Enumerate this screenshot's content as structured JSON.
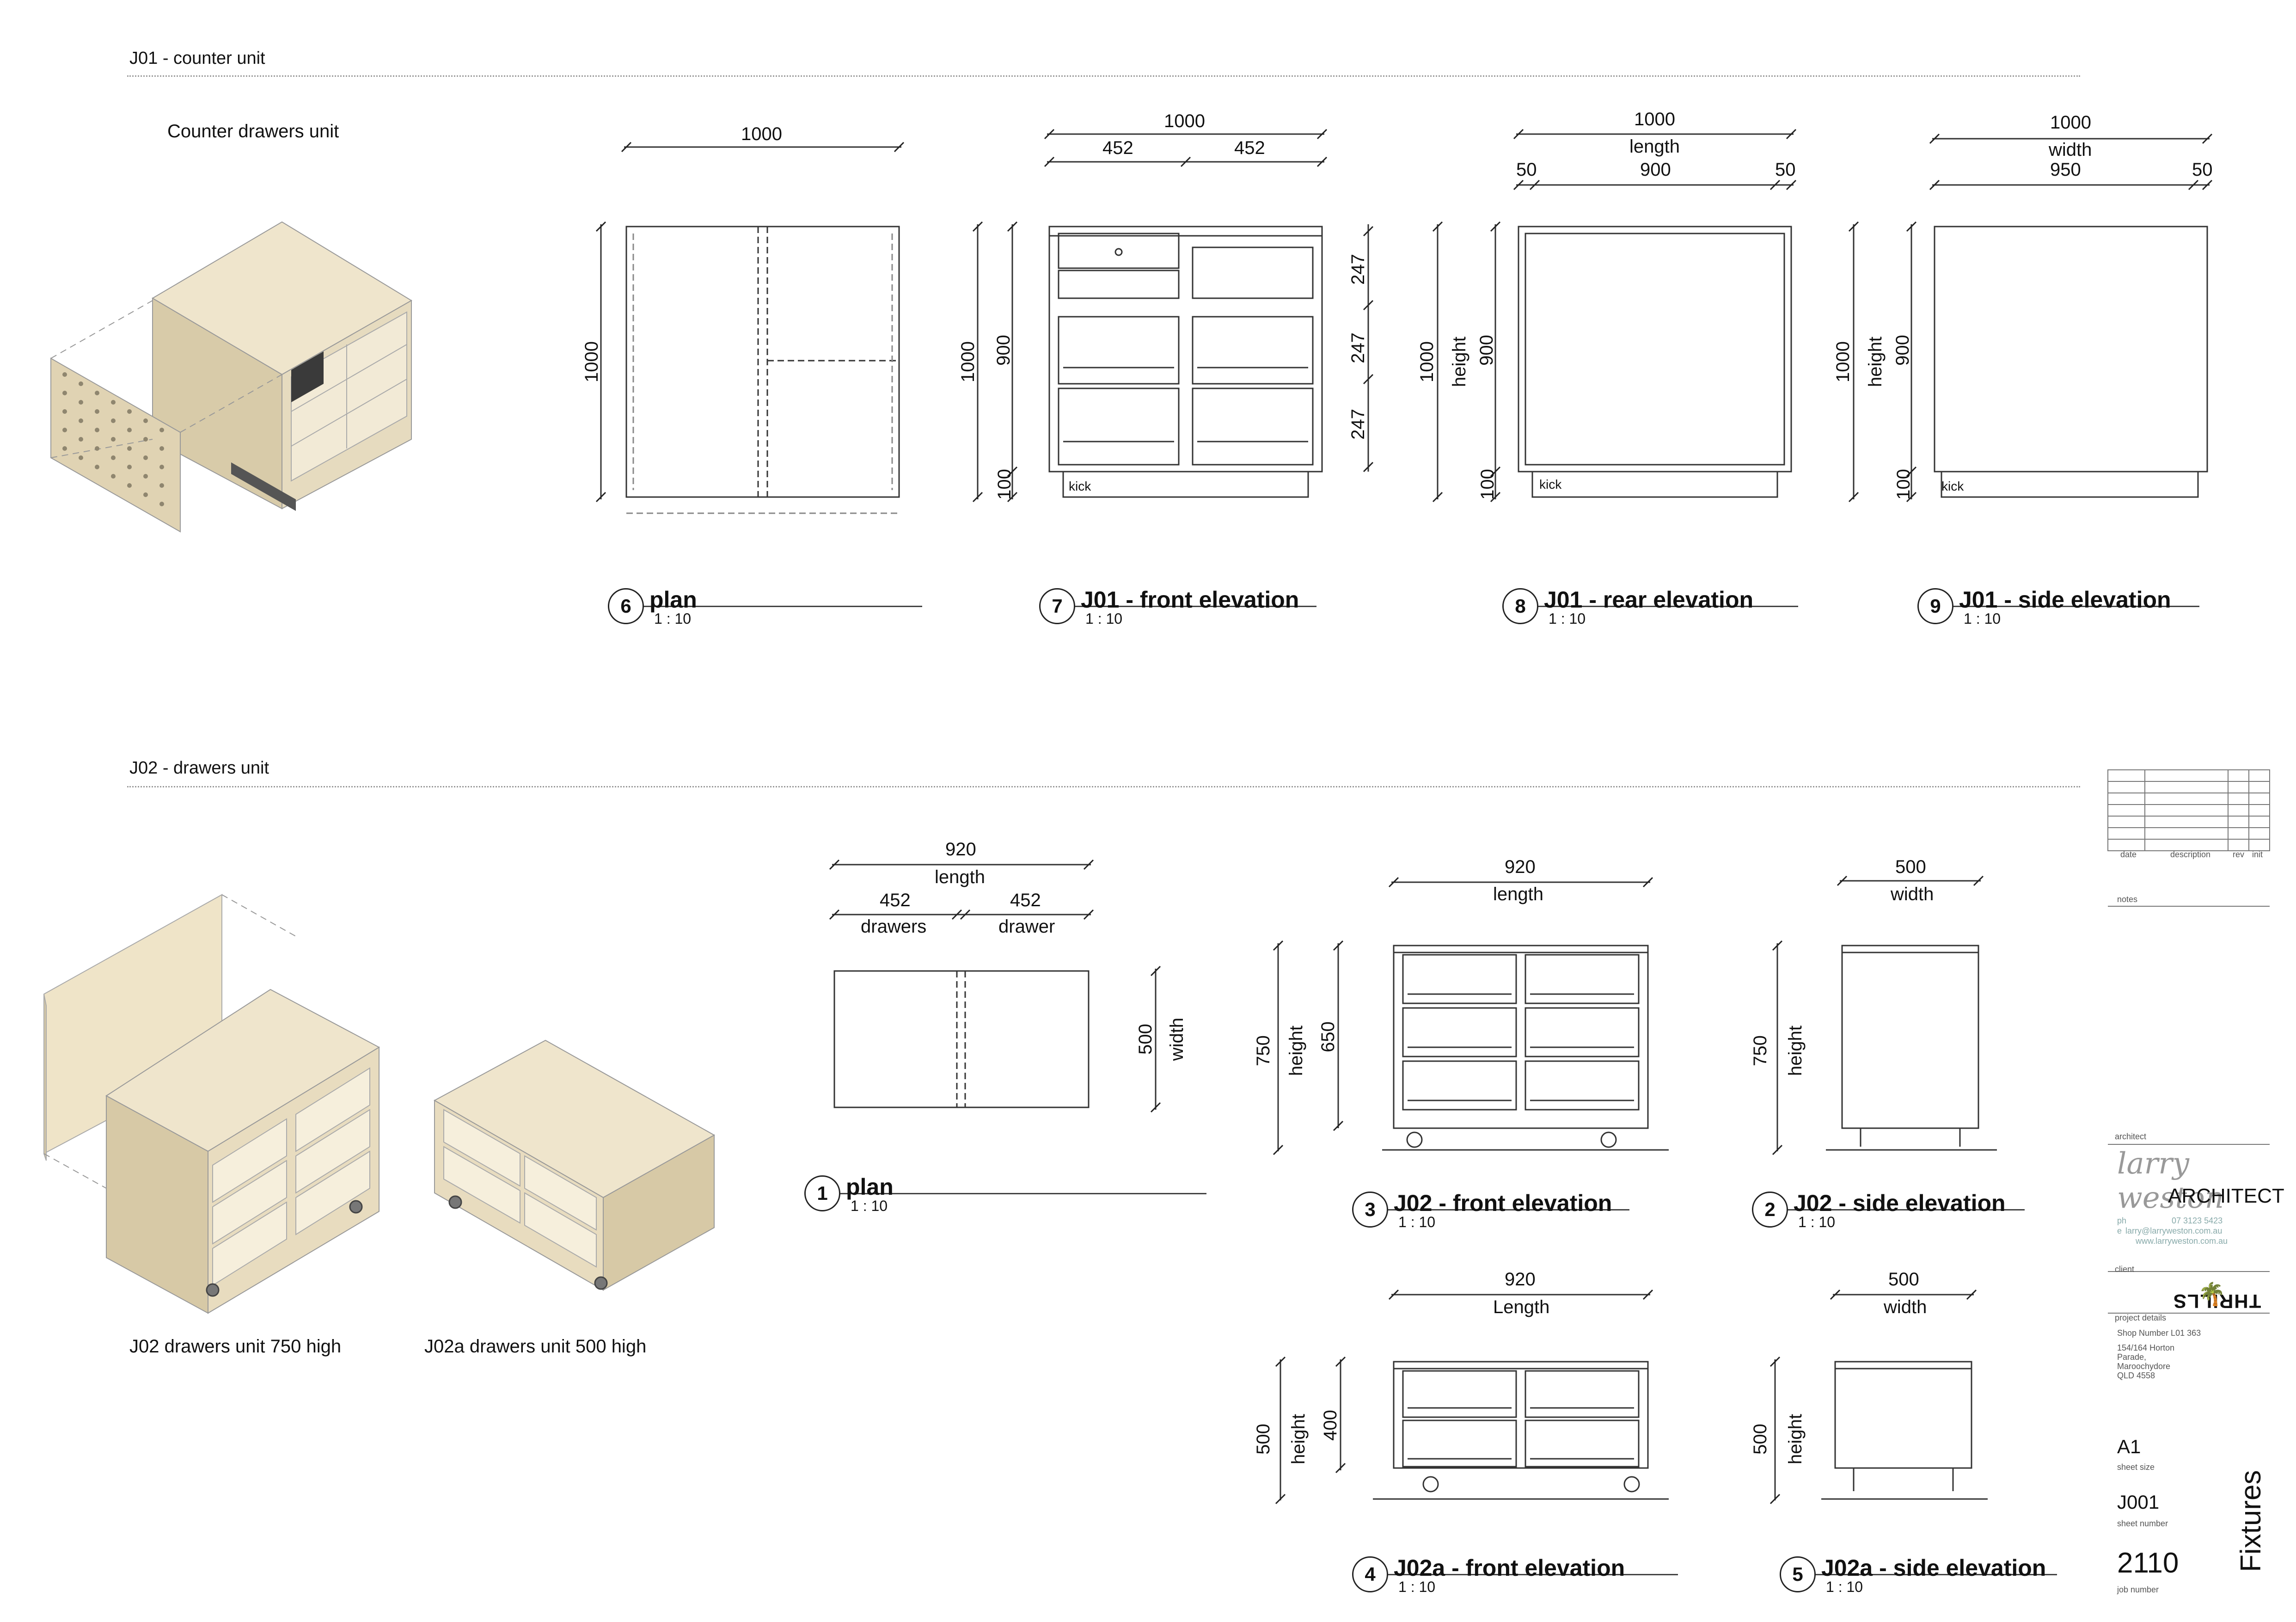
{
  "sections": {
    "j01": "J01 - counter unit",
    "j02": "J02 - drawers unit"
  },
  "iso": {
    "j01_label": "Counter drawers unit",
    "j02_label": "J02 drawers unit 750 high",
    "j02a_label": "J02a drawers unit 500 high"
  },
  "dims": {
    "d1000": "1000",
    "d452": "452",
    "d247": "247",
    "d900": "900",
    "d100": "100",
    "d50": "50",
    "d950": "950",
    "d920": "920",
    "d500": "500",
    "d750": "750",
    "d650": "650",
    "d400": "400",
    "length": "length",
    "Length": "Length",
    "width": "width",
    "height": "height",
    "drawers": "drawers",
    "drawer": "drawer",
    "kick": "kick"
  },
  "views": [
    {
      "num": "6",
      "name": "plan",
      "scale": "1 : 10"
    },
    {
      "num": "7",
      "name": "J01 - front elevation",
      "scale": "1 : 10"
    },
    {
      "num": "8",
      "name": "J01 - rear elevation",
      "scale": "1 : 10"
    },
    {
      "num": "9",
      "name": "J01 - side elevation",
      "scale": "1 : 10"
    },
    {
      "num": "1",
      "name": "plan",
      "scale": "1 : 10"
    },
    {
      "num": "3",
      "name": "J02 - front elevation",
      "scale": "1 : 10"
    },
    {
      "num": "2",
      "name": "J02 - side elevation",
      "scale": "1 : 10"
    },
    {
      "num": "4",
      "name": "J02a - front elevation",
      "scale": "1 : 10"
    },
    {
      "num": "5",
      "name": "J02a - side elevation",
      "scale": "1 : 10"
    }
  ],
  "title_block": {
    "rev_headers": [
      "date",
      "description",
      "rev",
      "init"
    ],
    "notes_label": "notes",
    "architect_label": "architect",
    "architect_name": "ARCHITECT",
    "architect_signature": "larry weston",
    "phone_label": "ph",
    "phone": "07 3123 5423",
    "email_label": "e",
    "email": "larry@larryweston.com.au",
    "web": "www.larryweston.com.au",
    "client_label": "client",
    "client_logo": "THRILLS",
    "project_label": "project details",
    "project_lines": [
      "Shop Number L01 363",
      "154/164 Horton",
      "Parade,",
      "Maroochydore",
      "QLD 4558"
    ],
    "sheet_size": "A1",
    "sheet_size_label": "sheet size",
    "sheet_number": "J001",
    "sheet_number_label": "sheet number",
    "job_number": "2110",
    "job_number_label": "job number",
    "sheet_title": "Fixtures"
  },
  "colors": {
    "wood": "#e8dcc0",
    "wood_dark": "#cbbd9c",
    "line": "#333333"
  }
}
